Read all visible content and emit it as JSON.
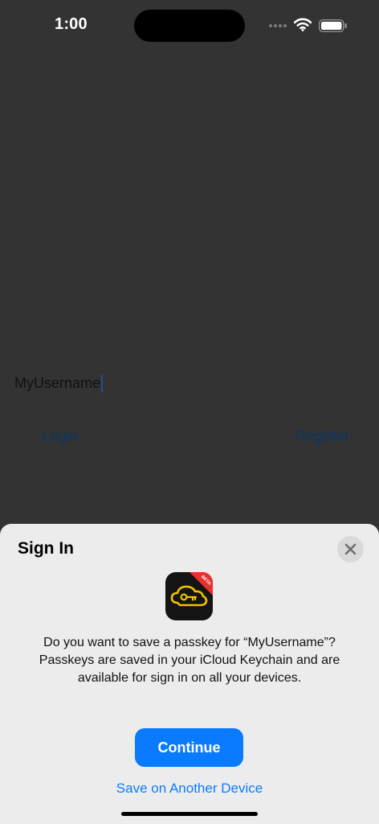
{
  "status_bar": {
    "time": "1:00",
    "icons": [
      "signal-icon",
      "wifi-icon",
      "battery-icon"
    ]
  },
  "app": {
    "username_value": "MyUsername",
    "login_label": "Login",
    "register_label": "Register"
  },
  "sheet": {
    "title": "Sign In",
    "close_icon": "close-icon",
    "app_icon": "passkey-app-icon",
    "badge_text": "BETA",
    "message_lines": [
      "Do you want to save a passkey for “MyUsername”?",
      "Passkeys are saved in your iCloud Keychain and are",
      "available for sign in on all your devices."
    ],
    "continue_label": "Continue",
    "other_device_label": "Save on Another Device"
  },
  "colors": {
    "accent": "#0a7bff",
    "dim_background": "#333333",
    "sheet_background": "#ececec",
    "icon_yellow": "#f2c200",
    "badge_red": "#e8312f"
  }
}
